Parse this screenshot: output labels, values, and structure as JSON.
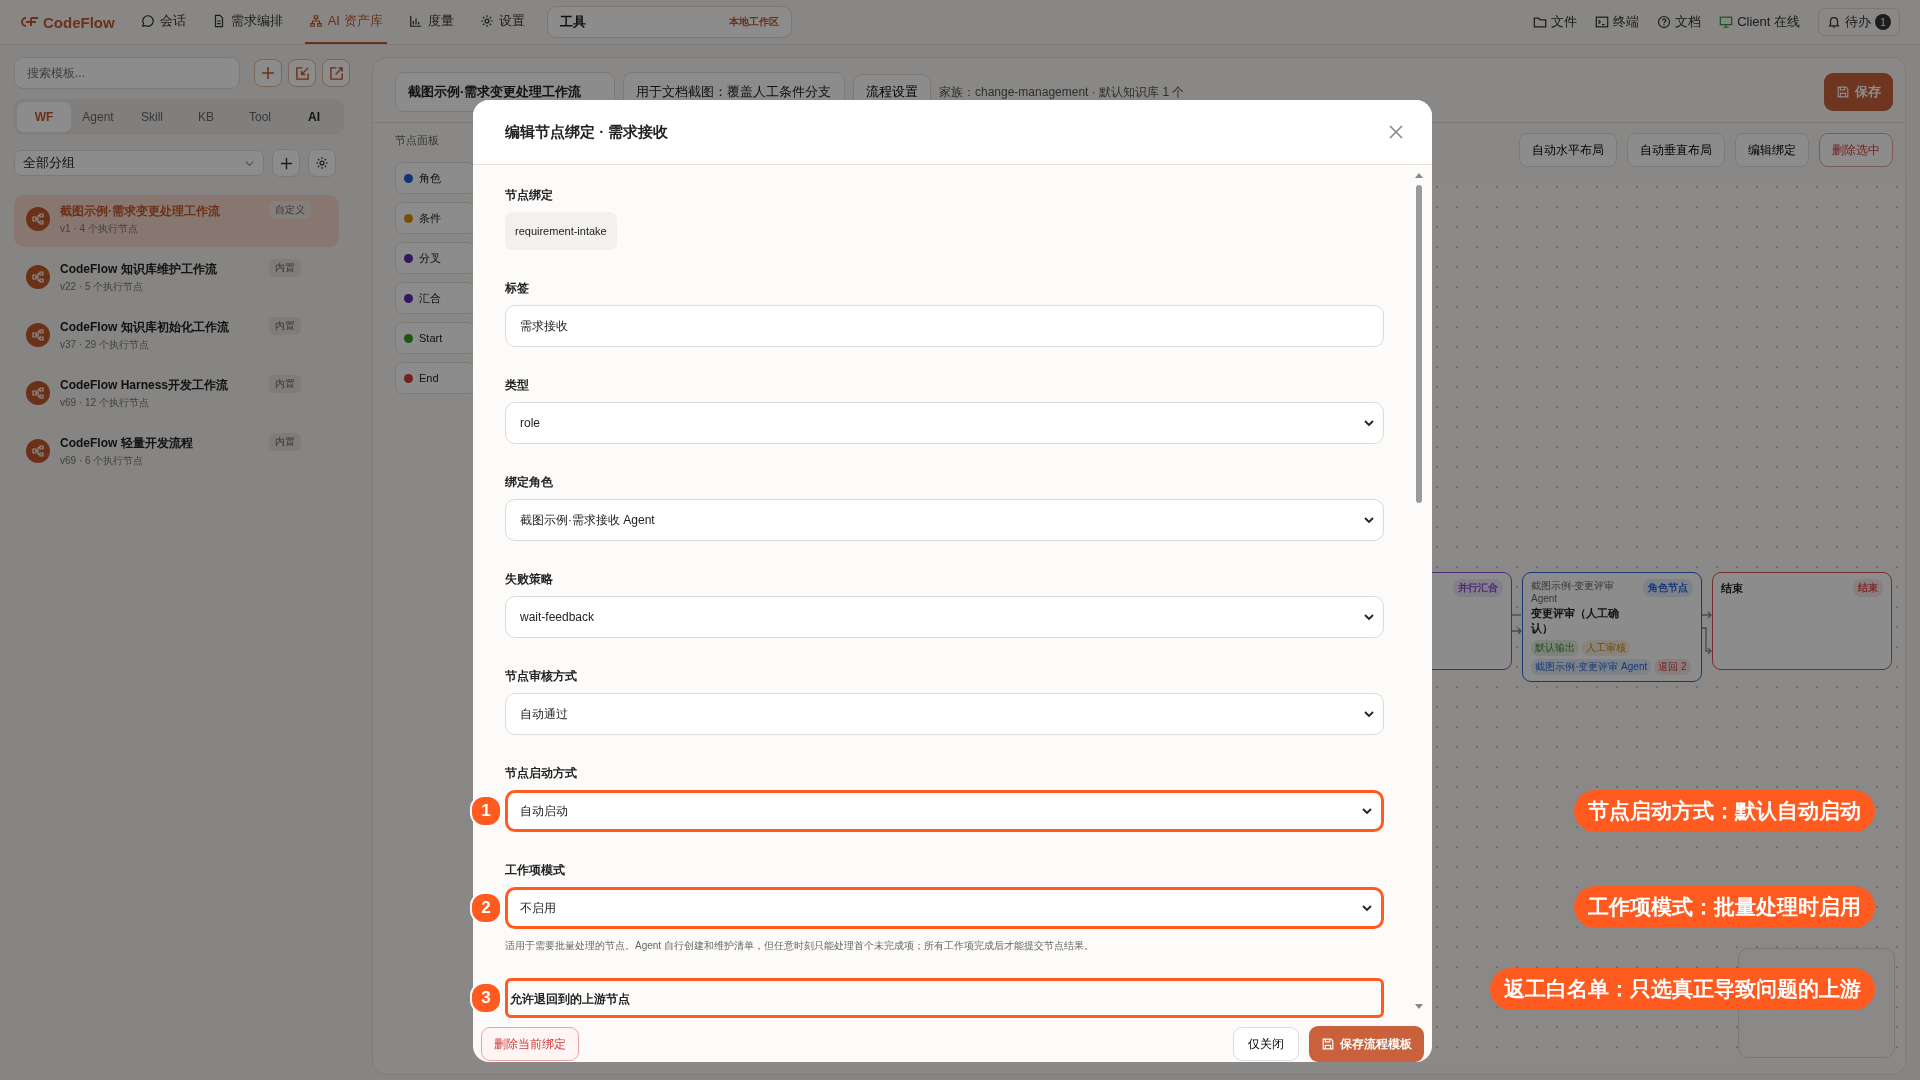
{
  "top_bar": {
    "logo": "CodeFlow",
    "nav": [
      {
        "label": "会话",
        "selected": false
      },
      {
        "label": "需求编排",
        "selected": false
      },
      {
        "label": "AI 资产库",
        "selected": true
      },
      {
        "label": "度量",
        "selected": false
      },
      {
        "label": "设置",
        "selected": false
      }
    ],
    "workspace": {
      "value": "工具",
      "badge": "本地工作区"
    },
    "links": [
      {
        "label": "文件"
      },
      {
        "label": "终端"
      },
      {
        "label": "文档"
      },
      {
        "label": "Client 在线"
      }
    ],
    "todo": {
      "label": "待办",
      "count": "1"
    }
  },
  "sidebar": {
    "search_placeholder": "搜索模板...",
    "tabs": [
      {
        "label": "WF",
        "selected": true,
        "kind": "plain"
      },
      {
        "label": "Agent",
        "selected": false,
        "kind": "plain"
      },
      {
        "label": "Skill",
        "selected": false,
        "kind": "plain"
      },
      {
        "label": "KB",
        "selected": false,
        "kind": "plain"
      },
      {
        "label": "Tool",
        "selected": false,
        "kind": "plain"
      },
      {
        "label": "AI",
        "selected": false,
        "kind": "strong"
      }
    ],
    "group_select": "全部分组",
    "templates": [
      {
        "name": "截图示例·需求变更处理工作流",
        "meta": "v1 · 4 个执行节点",
        "tag": "自定义",
        "selected": true
      },
      {
        "name": "CodeFlow 知识库维护工作流",
        "meta": "v22 · 5 个执行节点",
        "tag": "内置",
        "selected": false
      },
      {
        "name": "CodeFlow 知识库初始化工作流",
        "meta": "v37 · 29 个执行节点",
        "tag": "内置",
        "selected": false
      },
      {
        "name": "CodeFlow Harness开发工作流",
        "meta": "v69 · 12 个执行节点",
        "tag": "内置",
        "selected": false
      },
      {
        "name": "CodeFlow 轻量开发流程",
        "meta": "v69 · 6 个执行节点",
        "tag": "内置",
        "selected": false
      }
    ]
  },
  "workflow": {
    "name": "截图示例·需求变更处理工作流",
    "description": "用于文档截图：覆盖人工条件分支",
    "settings_button": "流程设置",
    "meta": "家族：change-management · 默认知识库 1 个",
    "save_button": "保存",
    "toolbar": [
      {
        "label": "自动水平布局",
        "kind": "normal"
      },
      {
        "label": "自动垂直布局",
        "kind": "normal"
      },
      {
        "label": "编辑绑定",
        "kind": "normal"
      },
      {
        "label": "删除选中",
        "kind": "danger"
      }
    ],
    "palette": {
      "title": "节点面板",
      "items": [
        {
          "label": "角色",
          "color": "#113277"
        },
        {
          "label": "条件",
          "color": "#754f08"
        },
        {
          "label": "分叉",
          "color": "#321861"
        },
        {
          "label": "汇合",
          "color": "#321861"
        },
        {
          "label": "Start",
          "color": "#205511"
        },
        {
          "label": "End",
          "color": "#742020"
        }
      ]
    },
    "canvas": {
      "nodes": [
        {
          "kind": "join",
          "badge": "并行汇合"
        },
        {
          "kind": "role",
          "subtitle": "截图示例·变更评审 Agent",
          "title": "变更评审（人工确认）",
          "badge": "角色节点",
          "tags": [
            {
              "label": "默认输出",
              "kind": "output"
            },
            {
              "label": "人工审核",
              "kind": "review"
            },
            {
              "label": "截图示例·变更评审 Agent",
              "kind": "agent"
            },
            {
              "label": "退回 2",
              "kind": "rollback"
            }
          ]
        },
        {
          "kind": "end",
          "title": "结束",
          "badge": "结束"
        }
      ]
    }
  },
  "modal": {
    "title": "编辑节点绑定 · 需求接收",
    "fields": [
      {
        "kind": "chip",
        "label": "节点绑定",
        "value": "requirement-intake",
        "highlighted": false
      },
      {
        "kind": "text",
        "label": "标签",
        "value": "需求接收",
        "highlighted": false
      },
      {
        "kind": "select",
        "label": "类型",
        "value": "role",
        "highlighted": false
      },
      {
        "kind": "select",
        "label": "绑定角色",
        "value": "截图示例·需求接收 Agent",
        "highlighted": false
      },
      {
        "kind": "select",
        "label": "失败策略",
        "value": "wait-feedback",
        "highlighted": false
      },
      {
        "kind": "select",
        "label": "节点审核方式",
        "value": "自动通过",
        "highlighted": false
      },
      {
        "kind": "select",
        "label": "节点启动方式",
        "value": "自动启动",
        "highlighted": true,
        "callout": "1"
      },
      {
        "kind": "select",
        "label": "工作项模式",
        "value": "不启用",
        "highlighted": true,
        "callout": "2",
        "help": "适用于需要批量处理的节点。Agent 自行创建和维护清单，但任意时刻只能处理首个未完成项；所有工作项完成后才能提交节点结果。"
      },
      {
        "kind": "section",
        "label": "允许退回到的上游节点",
        "highlighted": true,
        "callout": "3"
      }
    ],
    "delete_button": "删除当前绑定",
    "close_button": "仅关闭",
    "save_button": "保存流程模板"
  },
  "annotations": [
    {
      "text": "节点启动方式：默认自动启动"
    },
    {
      "text": "工作项模式：批量处理时启用"
    },
    {
      "text": "返工白名单：只选真正导致问题的上游"
    }
  ]
}
